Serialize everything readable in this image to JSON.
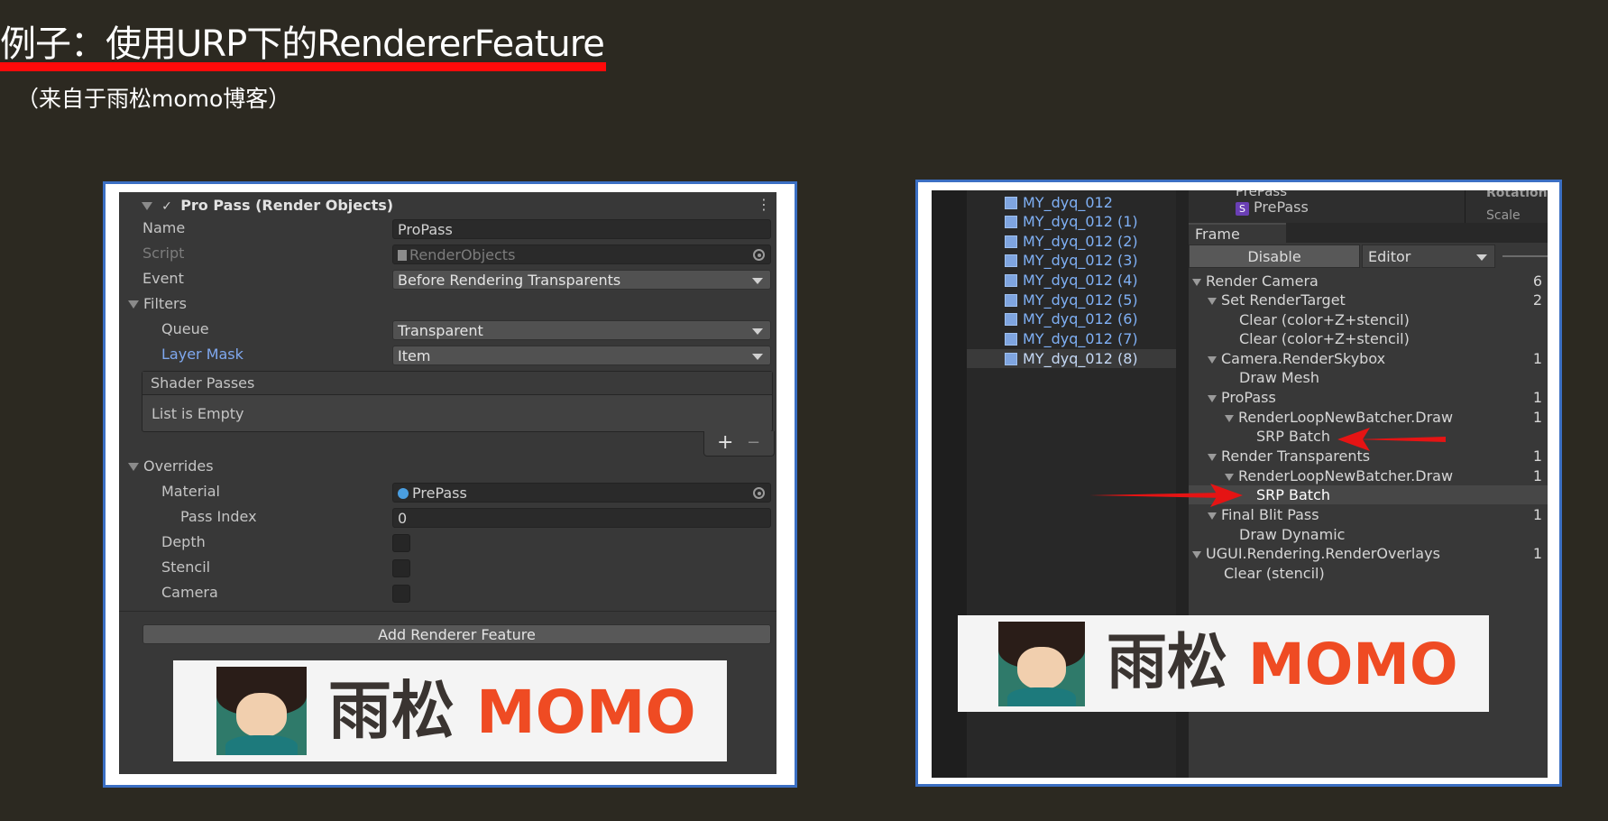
{
  "slide": {
    "title": "例子：使用URP下的RendererFeature",
    "subtitle": "（来自于雨松momo博客）",
    "accent_color": "#ff0a0a",
    "frame_color": "#3b6fc3"
  },
  "inspector": {
    "header": "Pro Pass (Render Objects)",
    "name_label": "Name",
    "name_value": "ProPass",
    "script_label": "Script",
    "script_value": "RenderObjects",
    "event_label": "Event",
    "event_value": "Before Rendering Transparents",
    "filters_label": "Filters",
    "queue_label": "Queue",
    "queue_value": "Transparent",
    "layer_mask_label": "Layer Mask",
    "layer_mask_value": "Item",
    "shader_passes_label": "Shader Passes",
    "list_empty_label": "List is Empty",
    "plus_icon": "+",
    "minus_icon": "−",
    "overrides_label": "Overrides",
    "material_label": "Material",
    "material_value": "PrePass",
    "pass_index_label": "Pass Index",
    "pass_index_value": "0",
    "depth_label": "Depth",
    "stencil_label": "Stencil",
    "camera_label": "Camera",
    "add_feature_label": "Add Renderer Feature"
  },
  "logo": {
    "cn_text": "雨松",
    "en_text": "MOMO"
  },
  "hierarchy": {
    "items": [
      "MY_dyq_012",
      "MY_dyq_012 (1)",
      "MY_dyq_012 (2)",
      "MY_dyq_012 (3)",
      "MY_dyq_012 (4)",
      "MY_dyq_012 (5)",
      "MY_dyq_012 (6)",
      "MY_dyq_012 (7)",
      "MY_dyq_012 (8)"
    ]
  },
  "project_items": {
    "top_cut": "PrePass",
    "prepass": "PrePass",
    "rotation": "Rotation",
    "scale": "Scale"
  },
  "frame_debug": {
    "tab_label": "Frame Debug",
    "disable_label": "Disable",
    "editor_label": "Editor",
    "tree": [
      {
        "label": "Render Camera",
        "count": "6"
      },
      {
        "label": "Set RenderTarget",
        "count": "2"
      },
      {
        "label": "Clear (color+Z+stencil)",
        "count": ""
      },
      {
        "label": "Clear (color+Z+stencil)",
        "count": ""
      },
      {
        "label": "Camera.RenderSkybox",
        "count": "1"
      },
      {
        "label": "Draw Mesh",
        "count": ""
      },
      {
        "label": "ProPass",
        "count": "1"
      },
      {
        "label": "RenderLoopNewBatcher.Draw",
        "count": "1"
      },
      {
        "label": "SRP Batch",
        "count": ""
      },
      {
        "label": "Render Transparents",
        "count": "1"
      },
      {
        "label": "RenderLoopNewBatcher.Draw",
        "count": "1"
      },
      {
        "label": "SRP Batch",
        "count": ""
      },
      {
        "label": "Final Blit Pass",
        "count": "1"
      },
      {
        "label": "Draw Dynamic",
        "count": ""
      },
      {
        "label": "UGUI.Rendering.RenderOverlays",
        "count": "1"
      },
      {
        "label": "Clear (stencil)",
        "count": ""
      }
    ]
  }
}
